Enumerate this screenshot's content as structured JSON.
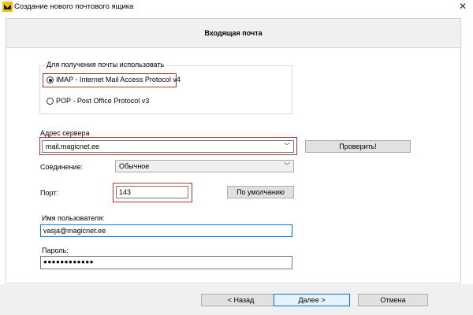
{
  "window": {
    "title": "Создание нового почтового ящика",
    "close_glyph": "✕",
    "icon": "app-mail-icon"
  },
  "header": {
    "title": "Входящая почта"
  },
  "protocol_group": {
    "legend": "Для получения почты использовать",
    "options": [
      {
        "label": "IMAP - Internet Mail Access Protocol v4",
        "selected": true
      },
      {
        "label": "POP  -  Post Office Protocol v3",
        "selected": false
      }
    ]
  },
  "server": {
    "label": "Адрес сервера",
    "value": "mail.magicnet.ee",
    "check_button": "Проверить!"
  },
  "connection": {
    "label": "Соединение:",
    "value": "Обычное"
  },
  "port": {
    "label": "Порт:",
    "value": "143",
    "default_button": "По умолчанию"
  },
  "username": {
    "label": "Имя пользователя:",
    "value": "vasja@magicnet.ee"
  },
  "password": {
    "label": "Пароль:",
    "value": "●●●●●●●●●●●●"
  },
  "footer": {
    "back_button": "<  Назад",
    "next_button": "Далее  >",
    "cancel_button": "Отмена"
  },
  "colors": {
    "highlight_box": "#b83232",
    "focus_border": "#0078d7",
    "panel_band": "#f0f0f0"
  }
}
